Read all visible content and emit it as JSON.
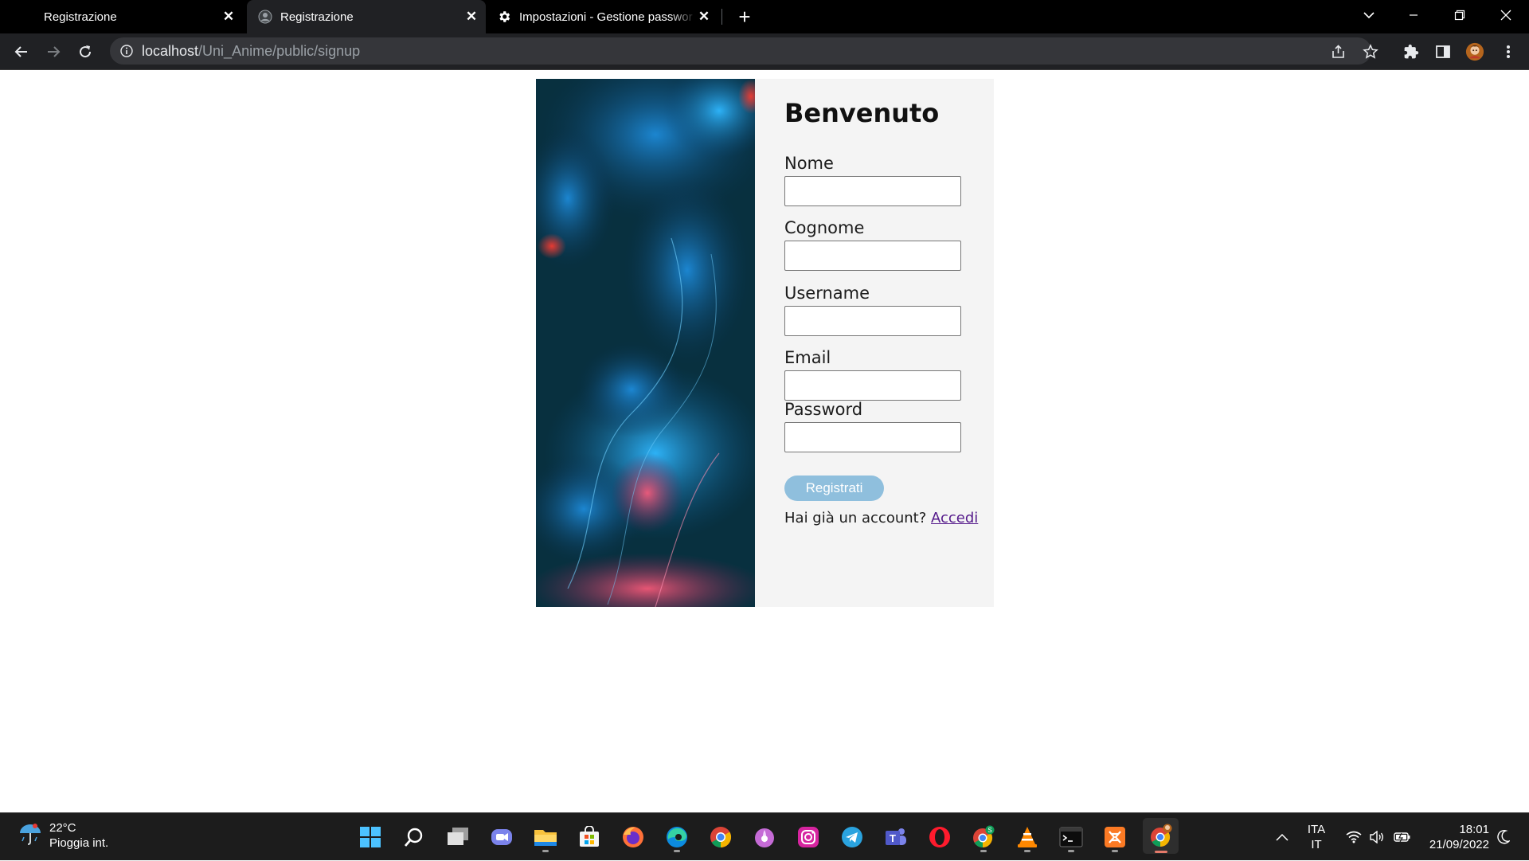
{
  "browser": {
    "tabs": [
      {
        "title": "Registrazione",
        "active": false
      },
      {
        "title": "Registrazione",
        "active": true
      },
      {
        "title": "Impostazioni - Gestione passwor",
        "active": false
      }
    ],
    "url_host": "localhost",
    "url_path": "/Uni_Anime/public/signup"
  },
  "page": {
    "heading": "Benvenuto",
    "fields": [
      {
        "label": "Nome",
        "value": "",
        "type": "text"
      },
      {
        "label": "Cognome",
        "value": "",
        "type": "text"
      },
      {
        "label": "Username",
        "value": "",
        "type": "text"
      },
      {
        "label": "Email",
        "value": "",
        "type": "email"
      },
      {
        "label": "Password",
        "value": "",
        "type": "password"
      }
    ],
    "submit_label": "Registrati",
    "login_prompt": "Hai già un account?",
    "login_link": "Accedi",
    "colors": {
      "submit": "#8fbfdd",
      "link": "#551a8b",
      "panel": "#f4f4f4"
    }
  },
  "taskbar": {
    "weather_temp": "22°C",
    "weather_desc": "Pioggia int.",
    "apps": [
      "windows-start-icon",
      "search-icon",
      "task-view-icon",
      "chat-icon",
      "file-explorer-icon",
      "store-icon",
      "firefox-icon",
      "edge-icon",
      "chrome-icon",
      "tor-icon",
      "instagram-icon",
      "telegram-icon",
      "teams-icon",
      "opera-icon",
      "chrome-profile-icon",
      "vlc-icon",
      "terminal-icon",
      "xampp-icon",
      "chrome-active-icon"
    ],
    "lang_line1": "ITA",
    "lang_line2": "IT",
    "time": "18:01",
    "date": "21/09/2022"
  }
}
